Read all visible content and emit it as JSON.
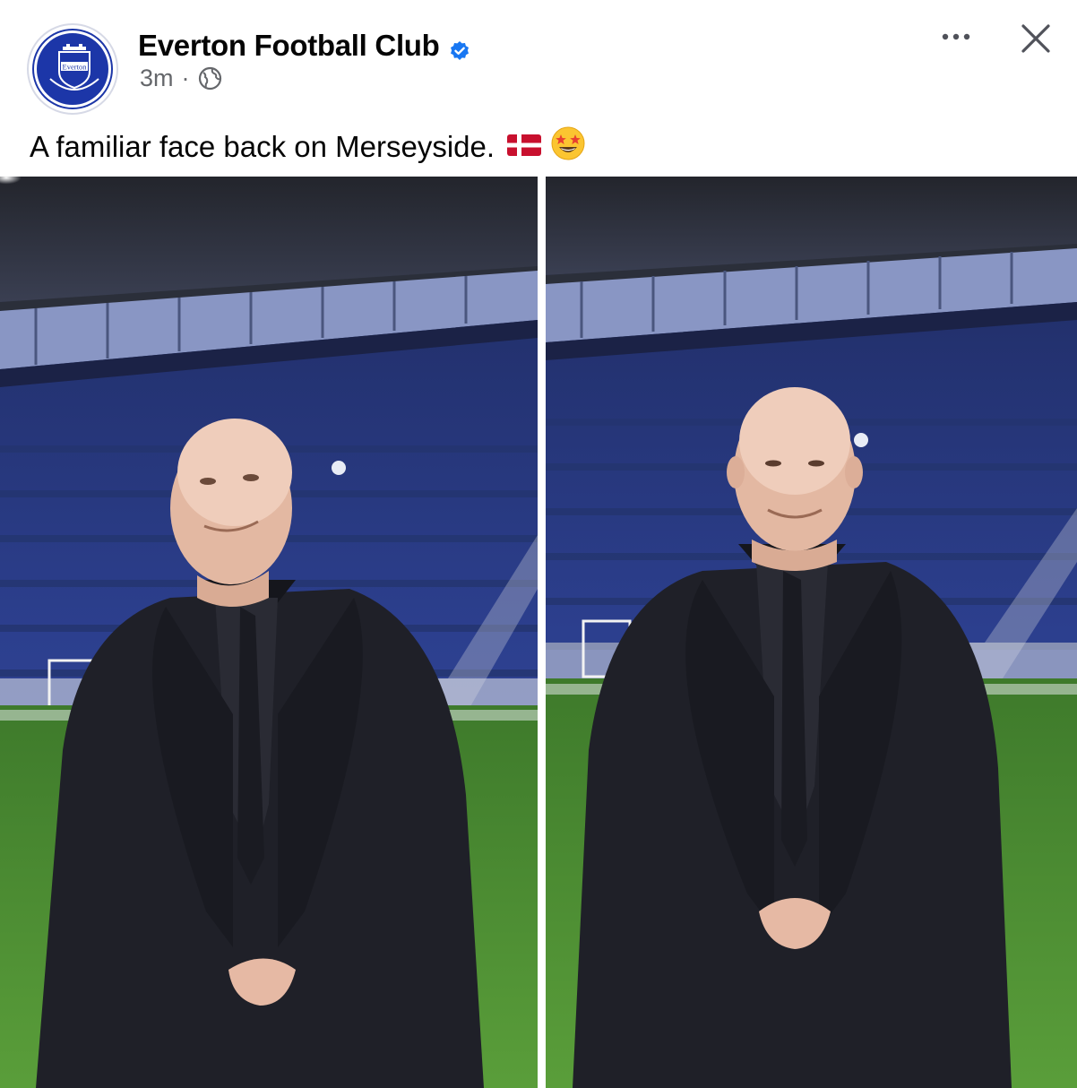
{
  "post": {
    "author": "Everton Football Club",
    "verified": true,
    "timestamp": "3m",
    "separator": "·",
    "audience_icon": "globe-icon",
    "caption": "A familiar face back on Merseyside.",
    "caption_emojis": [
      "denmark-flag-emoji",
      "star-struck-emoji"
    ],
    "avatar_icon": "everton-crest-icon",
    "avatar_text": "Everton"
  },
  "actions": {
    "more_icon": "more-options-icon",
    "close_icon": "close-icon"
  },
  "photos": [
    {
      "name": "photo-left",
      "subject": "man looking up",
      "pose": "looking-up"
    },
    {
      "name": "photo-right",
      "subject": "man smiling at camera",
      "pose": "smiling"
    }
  ],
  "colors": {
    "brand_blue": "#1c36a8",
    "verified_blue": "#1877f2",
    "meta_gray": "#65676b",
    "seat_blue": "#2b3f8f",
    "pitch_green": "#4e8f34",
    "coat": "#1f2028"
  }
}
